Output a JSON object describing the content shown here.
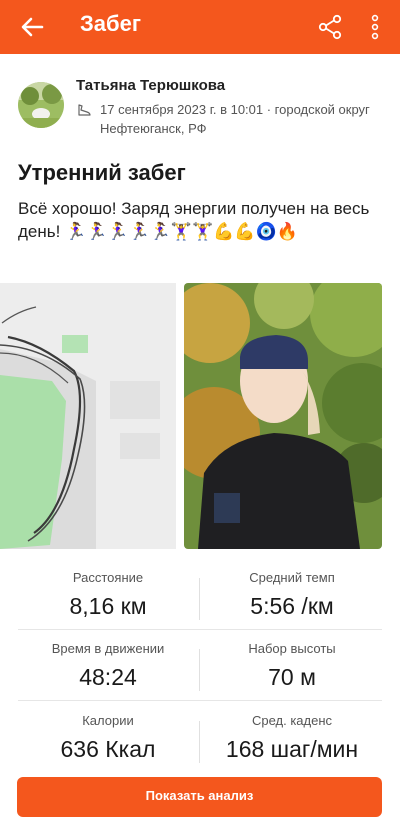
{
  "header": {
    "title": "Забег",
    "back_icon": "arrow-left-icon",
    "share_icon": "share-icon",
    "more_icon": "more-vertical-icon",
    "color": "#f4571d"
  },
  "athlete": {
    "name": "Татьяна Терюшкова",
    "meta": "17 сентября 2023 г. в 10:01 · городской округ Нефтеюганск, РФ",
    "meta_icon": "shoe-icon"
  },
  "activity": {
    "title": "Утренний забег",
    "description": "Всё хорошо! Заряд энергии получен на весь день! 🏃‍♀️🏃‍♀️🏃‍♀️🏃‍♀️🏃‍♀️🏋️‍♀️🏋️‍♀️💪💪🧿🔥"
  },
  "stats": [
    {
      "label": "Расстояние",
      "value": "8,16 км"
    },
    {
      "label": "Средний темп",
      "value": "5:56 /км"
    },
    {
      "label": "Время в движении",
      "value": "48:24"
    },
    {
      "label": "Набор высоты",
      "value": "70 м"
    },
    {
      "label": "Калории",
      "value": "636 Ккал"
    },
    {
      "label": "Сред. каденс",
      "value": "168 шаг/мин"
    }
  ],
  "actions": {
    "analyze_label": "Показать анализ"
  }
}
